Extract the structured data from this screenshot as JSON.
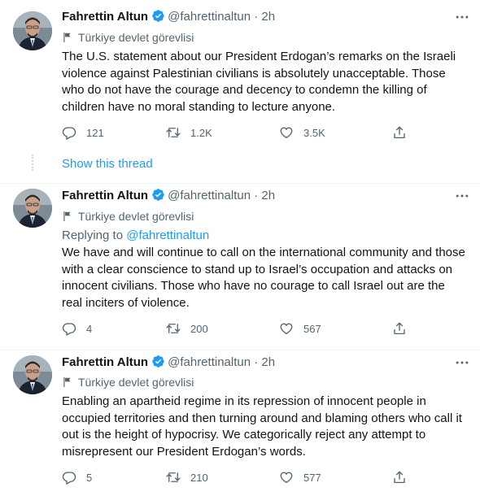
{
  "colors": {
    "accent": "#1d9bf0",
    "muted": "#536471",
    "text": "#0f1419",
    "verified": "#1d9bf0"
  },
  "icons": [
    "verified-badge-icon",
    "more-icon",
    "flag-icon",
    "reply-icon",
    "retweet-icon",
    "like-icon",
    "share-icon"
  ],
  "tweets": [
    {
      "name": "Fahrettin Altun",
      "handle": "@fahrettinaltun",
      "dot": "·",
      "time": "2h",
      "label": "Türkiye devlet görevlisi",
      "text": "The U.S. statement about our President Erdogan’s remarks on the Israeli violence against Palestinian civilians is absolutely unacceptable. Those who do not have the courage and decency to condemn the killing of children have no moral standing to lecture anyone.",
      "replies": "121",
      "retweets": "1.2K",
      "likes": "3.5K"
    },
    {
      "name": "Fahrettin Altun",
      "handle": "@fahrettinaltun",
      "dot": "·",
      "time": "2h",
      "label": "Türkiye devlet görevlisi",
      "replying_prefix": "Replying to",
      "replying_to": "@fahrettinaltun",
      "text": "We have and will continue to call on the international community and those with a clear conscience to stand up to Israel’s occupation and attacks on innocent civilians. Those who have no courage to call Israel out are the real inciters of violence.",
      "replies": "4",
      "retweets": "200",
      "likes": "567"
    },
    {
      "name": "Fahrettin Altun",
      "handle": "@fahrettinaltun",
      "dot": "·",
      "time": "2h",
      "label": "Türkiye devlet görevlisi",
      "text": "Enabling an apartheid regime in its repression of innocent people in occupied territories and then turning around and blaming others who call it out is the height of hypocrisy. We categorically reject any attempt to misrepresent our President Erdogan’s words.",
      "replies": "5",
      "retweets": "210",
      "likes": "577"
    }
  ],
  "show_thread": "Show this thread"
}
